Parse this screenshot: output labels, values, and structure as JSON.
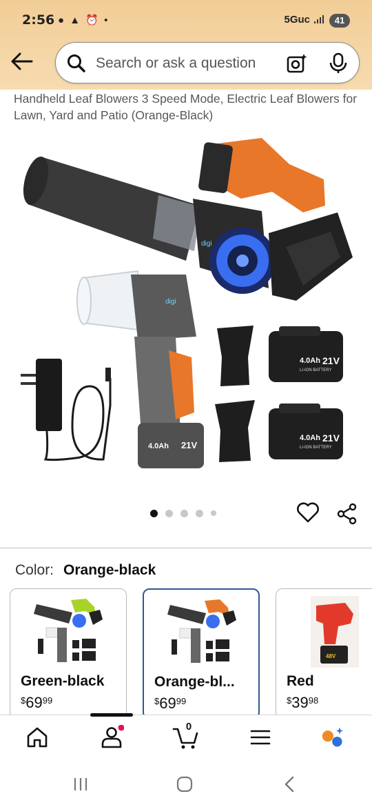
{
  "status_bar": {
    "time": "2:56",
    "indicators": "● ▲ ⏰ •",
    "network": "5Guc",
    "battery": "41"
  },
  "search": {
    "placeholder": "Search or ask a question"
  },
  "product": {
    "title": "Handheld Leaf Blowers 3 Speed Mode, Electric Leaf Blowers for Lawn, Yard and Patio (Orange-Black)",
    "image_labels": {
      "brand": "digi",
      "battery_capacity": "4.0Ah",
      "battery_voltage": "21V",
      "battery_type": "LI-ION BATTERY",
      "red_battery": "48V"
    },
    "gallery": {
      "total_images": 5,
      "active_index": 0
    }
  },
  "color_selector": {
    "label": "Color:",
    "selected": "Orange-black",
    "options": [
      {
        "name": "Green-black",
        "price_whole": "69",
        "price_fraction": "99",
        "currency": "$",
        "selected": false
      },
      {
        "name": "Orange-bl...",
        "price_whole": "69",
        "price_fraction": "99",
        "currency": "$",
        "selected": true
      },
      {
        "name": "Red",
        "price_whole": "39",
        "price_fraction": "98",
        "currency": "$",
        "selected": false
      }
    ]
  },
  "bottom_nav": {
    "cart_count": "0"
  },
  "colors": {
    "header_bg": "#f2cd96",
    "selected_border": "#2c5a8c",
    "notification_dot": "#e3125a",
    "orange_product": "#e8772a",
    "green_product": "#a8d42a",
    "red_product": "#e23a2a"
  }
}
